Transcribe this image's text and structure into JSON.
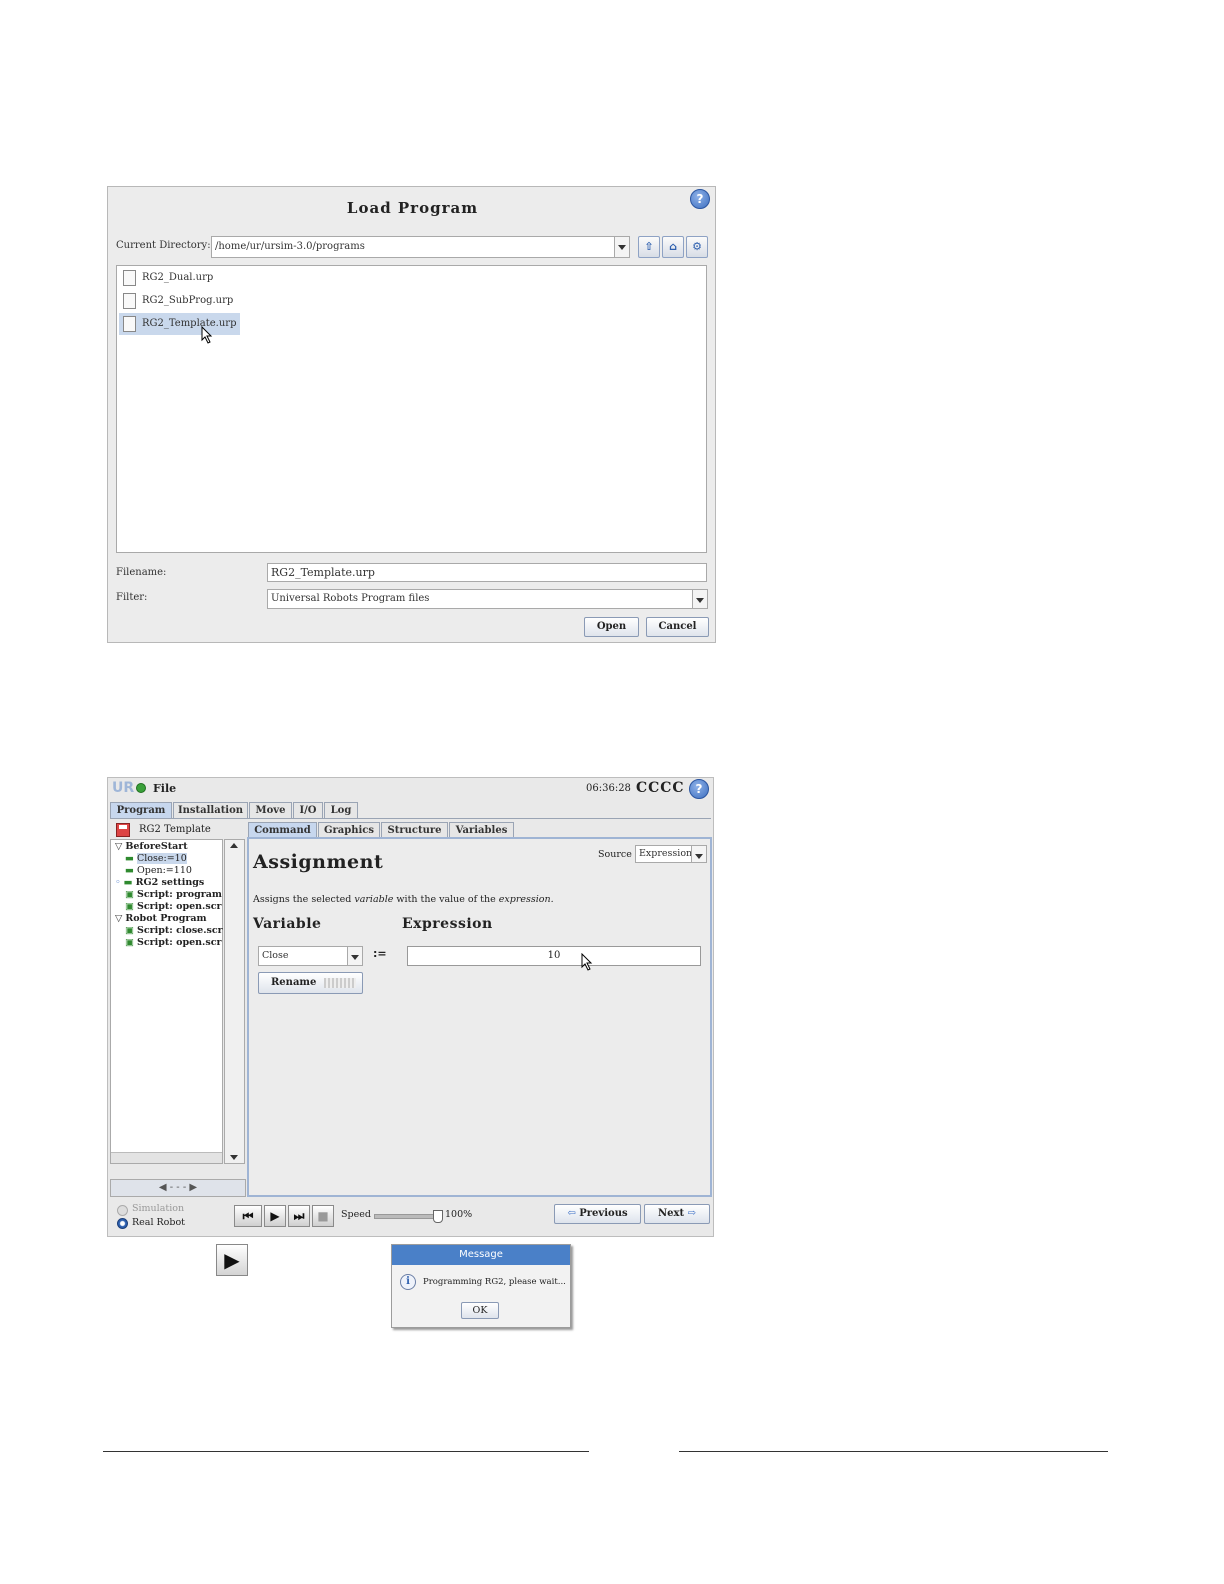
{
  "load_program": {
    "title": "Load Program",
    "help_icon": "?",
    "current_directory_label": "Current Directory:",
    "current_directory": "/home/ur/ursim-3.0/programs",
    "toolbar_icons": [
      "up-arrow-icon",
      "home-icon",
      "gear-icon"
    ],
    "files": [
      "RG2_Dual.urp",
      "RG2_SubProg.urp",
      "RG2_Template.urp"
    ],
    "selected_file": "RG2_Template.urp",
    "filename_label": "Filename:",
    "filename_value": "RG2_Template.urp",
    "filter_label": "Filter:",
    "filter_value": "Universal Robots Program files",
    "open_label": "Open",
    "cancel_label": "Cancel"
  },
  "polyscope": {
    "logo": "UR",
    "file_menu": "File",
    "clock": "06:36:28",
    "robot_name": "CCCC",
    "help_icon": "?",
    "main_tabs": [
      "Program",
      "Installation",
      "Move",
      "I/O",
      "Log"
    ],
    "program_name": "RG2 Template",
    "sub_tabs": [
      "Command",
      "Graphics",
      "Structure",
      "Variables"
    ],
    "tree": [
      "BeforeStart",
      "Close:=10",
      "Open:=110",
      "RG2 settings",
      "Script: program",
      "Script: open.scr",
      "Robot Program",
      "Script: close.scr",
      "Script: open.scr"
    ],
    "panel_toggle": "◀ - - - ▶",
    "source_label": "Source",
    "source_value": "Expression",
    "heading": "Assignment",
    "description_pre": "Assigns the selected ",
    "description_var": "variable",
    "description_mid": " with the value of the ",
    "description_expr": "expression.",
    "variable_heading": "Variable",
    "expression_heading": "Expression",
    "variable_value": "Close",
    "assign_symbol": ":=",
    "expression_value": "10",
    "rename_label": "Rename",
    "simulation_label": "Simulation",
    "real_robot_label": "Real Robot",
    "speed_label": "Speed",
    "speed_value": "100%",
    "speed_fraction": 1.0,
    "previous_label": "Previous",
    "next_label": "Next"
  },
  "play_button": "▶",
  "message": {
    "title": "Message",
    "text": "Programming RG2, please wait...",
    "ok_label": "OK"
  },
  "colors": {
    "accent": "#4a80c8",
    "selection": "#c9d8ec",
    "script_green": "#2f8a2f"
  }
}
